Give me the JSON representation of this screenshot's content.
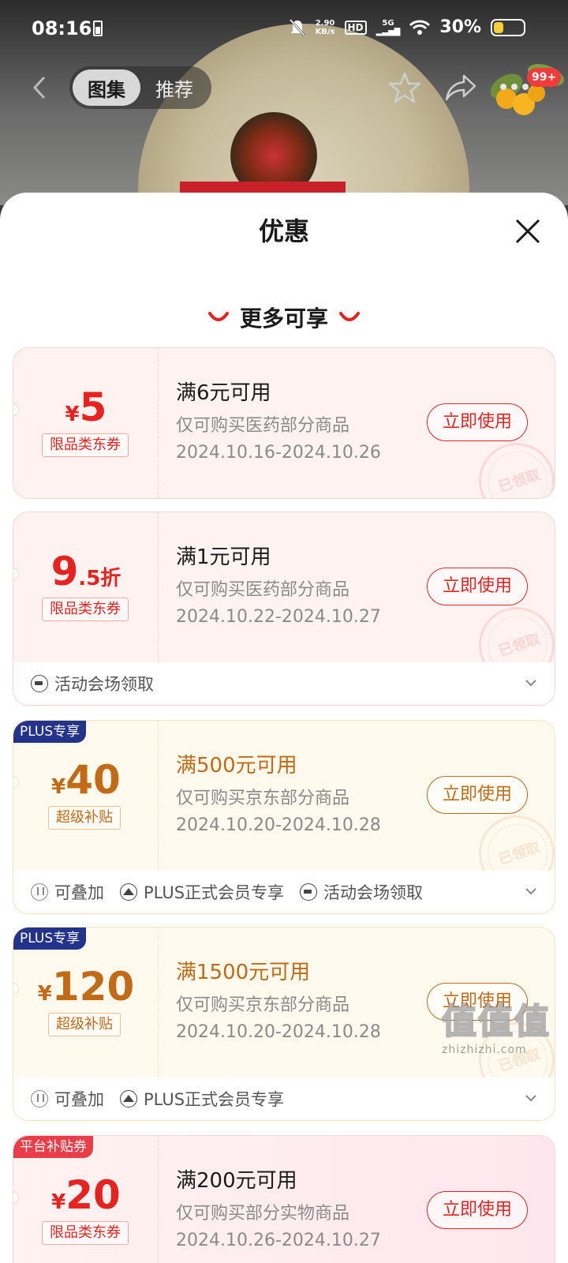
{
  "status_bar": {
    "time": "08:16",
    "net_speed_value": "2.90",
    "net_speed_unit": "KB/s",
    "hd": "HD",
    "signal": "5G",
    "battery": "30%"
  },
  "nav": {
    "tabs": [
      {
        "label": "图集",
        "active": true
      },
      {
        "label": "推荐",
        "active": false
      }
    ],
    "badge": "99+"
  },
  "sheet": {
    "title": "优惠",
    "section": "更多可享",
    "coupons": [
      {
        "currency": "¥",
        "amount": "5",
        "suffix": "",
        "tag": "限品类东券",
        "condition": "满6元可用",
        "scope": "仅可购买医药部分商品",
        "date": "2024.10.16-2024.10.26",
        "button": "立即使用",
        "stamp": "已领取"
      },
      {
        "currency": "",
        "amount": "9",
        "suffix": ".5折",
        "tag": "限品类东券",
        "condition": "满1元可用",
        "scope": "仅可购买医药部分商品",
        "date": "2024.10.22-2024.10.27",
        "button": "立即使用",
        "stamp": "已领取",
        "features": [
          "活动会场领取"
        ]
      },
      {
        "badge": "PLUS专享",
        "currency": "¥",
        "amount": "40",
        "suffix": "",
        "tag": "超级补贴",
        "condition": "满500元可用",
        "scope": "仅可购买京东部分商品",
        "date": "2024.10.20-2024.10.28",
        "button": "立即使用",
        "stamp": "已领取",
        "features": [
          "可叠加",
          "PLUS正式会员专享",
          "活动会场领取"
        ]
      },
      {
        "badge": "PLUS专享",
        "currency": "¥",
        "amount": "120",
        "suffix": "",
        "tag": "超级补贴",
        "condition": "满1500元可用",
        "scope": "仅可购买京东部分商品",
        "date": "2024.10.20-2024.10.28",
        "button": "立即使用",
        "stamp": "已领取",
        "features": [
          "可叠加",
          "PLUS正式会员专享"
        ]
      },
      {
        "badge": "平台补贴券",
        "currency": "¥",
        "amount": "20",
        "suffix": "",
        "tag": "限品类东券",
        "condition": "满200元可用",
        "scope": "仅可购买部分实物商品",
        "date": "2024.10.26-2024.10.27",
        "button": "立即使用"
      }
    ]
  },
  "watermark": {
    "big": "值值值",
    "small": "zhizhizhi.com"
  },
  "colors": {
    "accent_red": "#e8231f",
    "gold": "#c26a16",
    "plus_blue": "#23338c",
    "platform_red": "#ea3d47"
  }
}
